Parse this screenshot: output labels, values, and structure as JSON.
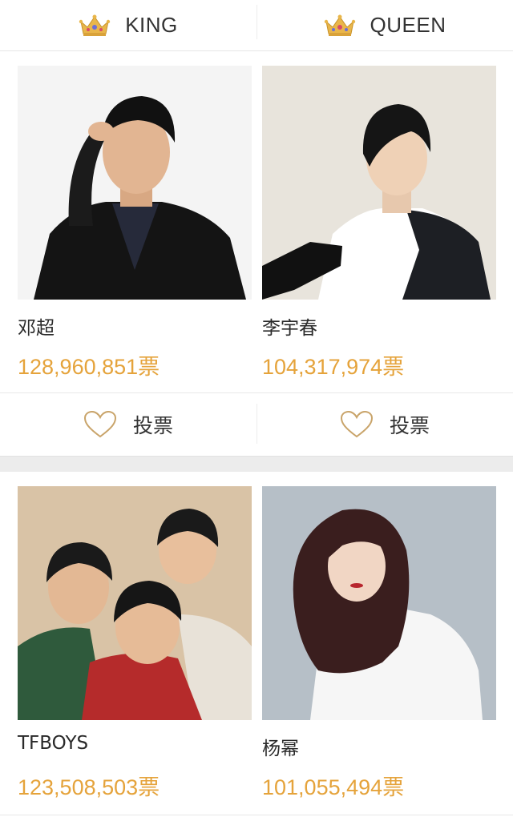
{
  "tabs": [
    {
      "label": "KING",
      "icon": "crown-icon"
    },
    {
      "label": "QUEEN",
      "icon": "crown-icon"
    }
  ],
  "colors": {
    "accent": "#e5a33b",
    "crown_gold": "#e9b64a",
    "heart_gold": "#c9a46a"
  },
  "cards": [
    {
      "name": "邓超",
      "votes": "128,960,851票"
    },
    {
      "name": "李宇春",
      "votes": "104,317,974票"
    },
    {
      "name": "TFBOYS",
      "votes": "123,508,503票"
    },
    {
      "name": "杨幂",
      "votes": "101,055,494票"
    }
  ],
  "vote_label": "投票"
}
